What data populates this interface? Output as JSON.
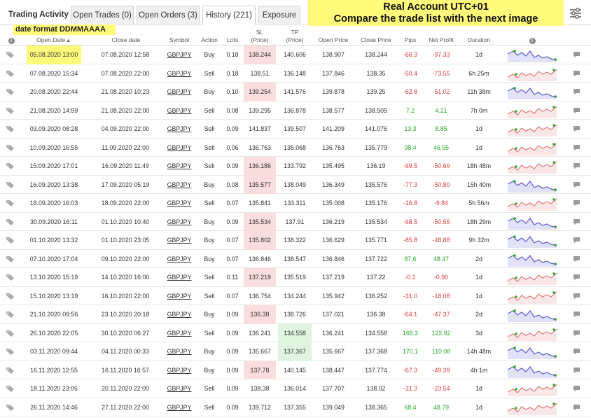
{
  "tabs": {
    "title": "Trading Activity",
    "open_trades": "Open Trades (0)",
    "open_orders": "Open Orders (3)",
    "history": "History (221)",
    "exposure": "Exposure"
  },
  "banner": {
    "line1": "Real Account UTC+01",
    "line2": "Compare the trade list with the next image"
  },
  "date_format_note": "date format DDMMAAAA",
  "columns": {
    "open_date": "Open Date ▴",
    "close_date": "Close date",
    "symbol": "Symbol",
    "action": "Action",
    "lots": "Lots",
    "sl": "SL",
    "tp": "TP",
    "price_unit": "(Price)",
    "open_price": "Open Price",
    "close_price": "Close Price",
    "pips": "Pips",
    "net_profit": "Net Profit",
    "duration": "Duration"
  },
  "colors": {
    "highlight": "#fffa7a",
    "sl_hit": "#fadddd",
    "tp_hit": "#dff5df",
    "loss": "#e03b3b",
    "profit": "#2aa72a",
    "spark_down": "#5b5bd6",
    "spark_up": "#e07a7a"
  },
  "trades": [
    {
      "open": "05.08.2020 13:00",
      "close": "07.08.2020 12:58",
      "symbol": "GBPJPY",
      "action": "Buy",
      "lots": "0.18",
      "sl": "138.244",
      "tp": "140.606",
      "open_price": "138.907",
      "close_price": "138.244",
      "pips": "-66.3",
      "profit": "-97.33",
      "duration": "1d",
      "hit": "sl",
      "trend": "down"
    },
    {
      "open": "07.08.2020 15:34",
      "close": "07.08.2020 22:00",
      "symbol": "GBPJPY",
      "action": "Sell",
      "lots": "0.18",
      "sl": "138.51",
      "tp": "136.148",
      "open_price": "137.846",
      "close_price": "138.35",
      "pips": "-50.4",
      "profit": "-73.55",
      "duration": "6h 25m",
      "hit": "",
      "trend": "up"
    },
    {
      "open": "20.08.2020 22:44",
      "close": "21.08.2020 10:23",
      "symbol": "GBPJPY",
      "action": "Buy",
      "lots": "0.10",
      "sl": "139.254",
      "tp": "141.576",
      "open_price": "139.878",
      "close_price": "139.25",
      "pips": "-62.8",
      "profit": "-51.02",
      "duration": "11h 38m",
      "hit": "sl",
      "trend": "down"
    },
    {
      "open": "21.08.2020 14:59",
      "close": "21.08.2020 22:00",
      "symbol": "GBPJPY",
      "action": "Sell",
      "lots": "0.08",
      "sl": "139.295",
      "tp": "136.878",
      "open_price": "138.577",
      "close_price": "138.505",
      "pips": "7.2",
      "profit": "4.21",
      "duration": "7h 0m",
      "hit": "",
      "trend": "up"
    },
    {
      "open": "03.09.2020 08:28",
      "close": "04.09.2020 22:00",
      "symbol": "GBPJPY",
      "action": "Sell",
      "lots": "0.09",
      "sl": "141.837",
      "tp": "139.507",
      "open_price": "141.209",
      "close_price": "141.076",
      "pips": "13.3",
      "profit": "8.85",
      "duration": "1d",
      "hit": "",
      "trend": "up"
    },
    {
      "open": "10.09.2020 16:55",
      "close": "11.09.2020 22:00",
      "symbol": "GBPJPY",
      "action": "Sell",
      "lots": "0.06",
      "sl": "136.763",
      "tp": "135.068",
      "open_price": "136.763",
      "close_price": "135.779",
      "pips": "98.4",
      "profit": "46.55",
      "duration": "1d",
      "hit": "",
      "trend": "up"
    },
    {
      "open": "15.09.2020 17:01",
      "close": "16.09.2020 11:49",
      "symbol": "GBPJPY",
      "action": "Sell",
      "lots": "0.09",
      "sl": "136.186",
      "tp": "133.792",
      "open_price": "135.495",
      "close_price": "136.19",
      "pips": "-69.5",
      "profit": "-50.69",
      "duration": "18h 48m",
      "hit": "sl",
      "trend": "up"
    },
    {
      "open": "16.09.2020 13:38",
      "close": "17.09.2020 05:19",
      "symbol": "GBPJPY",
      "action": "Buy",
      "lots": "0.08",
      "sl": "135.577",
      "tp": "138.049",
      "open_price": "136.349",
      "close_price": "135.576",
      "pips": "-77.3",
      "profit": "-50.80",
      "duration": "15h 40m",
      "hit": "sl",
      "trend": "down"
    },
    {
      "open": "18.09.2020 16:03",
      "close": "18.09.2020 22:00",
      "symbol": "GBPJPY",
      "action": "Sell",
      "lots": "0.07",
      "sl": "135.841",
      "tp": "133.311",
      "open_price": "135.008",
      "close_price": "135.176",
      "pips": "-16.8",
      "profit": "-9.84",
      "duration": "5h 56m",
      "hit": "",
      "trend": "up"
    },
    {
      "open": "30.09.2020 16:11",
      "close": "01.10.2020 10:40",
      "symbol": "GBPJPY",
      "action": "Buy",
      "lots": "0.09",
      "sl": "135.534",
      "tp": "137.91",
      "open_price": "136.219",
      "close_price": "135.534",
      "pips": "-68.5",
      "profit": "-50.55",
      "duration": "18h 29m",
      "hit": "sl",
      "trend": "down"
    },
    {
      "open": "01.10.2020 13:32",
      "close": "01.10.2020 23:05",
      "symbol": "GBPJPY",
      "action": "Buy",
      "lots": "0.07",
      "sl": "135.802",
      "tp": "138.322",
      "open_price": "136.629",
      "close_price": "135.771",
      "pips": "-85.8",
      "profit": "-48.88",
      "duration": "9h 32m",
      "hit": "sl",
      "trend": "down"
    },
    {
      "open": "07.10.2020 17:04",
      "close": "09.10.2020 22:00",
      "symbol": "GBPJPY",
      "action": "Buy",
      "lots": "0.07",
      "sl": "136.846",
      "tp": "138.547",
      "open_price": "136.846",
      "close_price": "137.722",
      "pips": "87.6",
      "profit": "48.47",
      "duration": "2d",
      "hit": "",
      "trend": "down"
    },
    {
      "open": "13.10.2020 15:19",
      "close": "14.10.2020 16:00",
      "symbol": "GBPJPY",
      "action": "Sell",
      "lots": "0.11",
      "sl": "137.219",
      "tp": "135.519",
      "open_price": "137.219",
      "close_price": "137.22",
      "pips": "-0.1",
      "profit": "-0.90",
      "duration": "1d",
      "hit": "sl",
      "trend": "up"
    },
    {
      "open": "15.10.2020 13:19",
      "close": "16.10.2020 22:00",
      "symbol": "GBPJPY",
      "action": "Sell",
      "lots": "0.07",
      "sl": "136.754",
      "tp": "134.244",
      "open_price": "135.942",
      "close_price": "136.252",
      "pips": "-31.0",
      "profit": "-18.08",
      "duration": "1d",
      "hit": "",
      "trend": "up"
    },
    {
      "open": "21.10.2020 09:56",
      "close": "23.10.2020 20:18",
      "symbol": "GBPJPY",
      "action": "Buy",
      "lots": "0.09",
      "sl": "136.38",
      "tp": "138.726",
      "open_price": "137.021",
      "close_price": "136.38",
      "pips": "-64.1",
      "profit": "-47.37",
      "duration": "2d",
      "hit": "sl",
      "trend": "down"
    },
    {
      "open": "26.10.2020 22:05",
      "close": "30.10.2020 06:27",
      "symbol": "GBPJPY",
      "action": "Sell",
      "lots": "0.09",
      "sl": "136.241",
      "tp": "134.558",
      "open_price": "136.241",
      "close_price": "134.558",
      "pips": "168.3",
      "profit": "122.92",
      "duration": "3d",
      "hit": "tp",
      "trend": "up"
    },
    {
      "open": "03.11.2020 09:44",
      "close": "04.11.2020 00:33",
      "symbol": "GBPJPY",
      "action": "Buy",
      "lots": "0.09",
      "sl": "135.667",
      "tp": "137.367",
      "open_price": "135.667",
      "close_price": "137.368",
      "pips": "170.1",
      "profit": "110.08",
      "duration": "14h 48m",
      "hit": "tp",
      "trend": "down"
    },
    {
      "open": "16.11.2020 12:55",
      "close": "16.11.2020 16:57",
      "symbol": "GBPJPY",
      "action": "Buy",
      "lots": "0.09",
      "sl": "137.78",
      "tp": "140.145",
      "open_price": "138.447",
      "close_price": "137.774",
      "pips": "-67.3",
      "profit": "-49.39",
      "duration": "4h 1m",
      "hit": "sl",
      "trend": "down"
    },
    {
      "open": "18.11.2020 23:05",
      "close": "20.11.2020 22:00",
      "symbol": "GBPJPY",
      "action": "Sell",
      "lots": "0.09",
      "sl": "138.38",
      "tp": "136.014",
      "open_price": "137.707",
      "close_price": "138.02",
      "pips": "-31.3",
      "profit": "-23.54",
      "duration": "1d",
      "hit": "",
      "trend": "up"
    },
    {
      "open": "26.11.2020 14:46",
      "close": "27.11.2020 22:00",
      "symbol": "GBPJPY",
      "action": "Sell",
      "lots": "0.09",
      "sl": "139.712",
      "tp": "137.355",
      "open_price": "139.049",
      "close_price": "138.365",
      "pips": "68.4",
      "profit": "48.79",
      "duration": "1d",
      "hit": "",
      "trend": "up"
    }
  ]
}
